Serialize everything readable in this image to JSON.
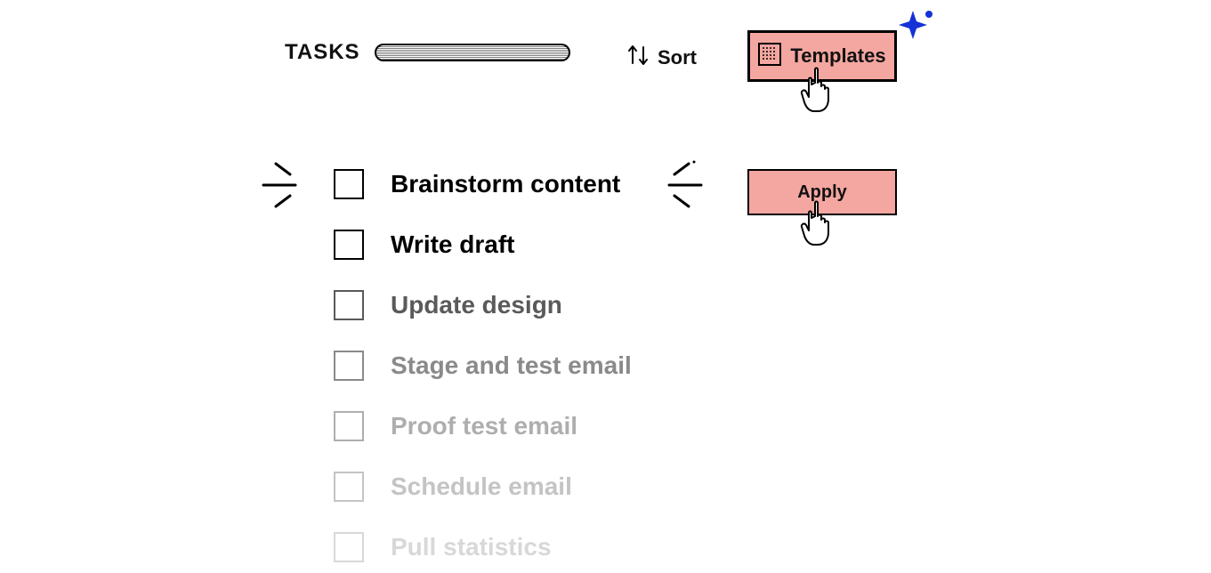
{
  "header": {
    "title": "TASKS",
    "sort_label": "Sort",
    "templates_label": "Templates"
  },
  "buttons": {
    "apply_label": "Apply"
  },
  "tasks": [
    {
      "label": "Brainstorm content",
      "emphasis": "op100",
      "highlighted": true
    },
    {
      "label": "Write draft",
      "emphasis": "op100"
    },
    {
      "label": "Update design",
      "emphasis": "op70"
    },
    {
      "label": "Stage and test email",
      "emphasis": "op55"
    },
    {
      "label": "Proof test email",
      "emphasis": "op40"
    },
    {
      "label": "Schedule email",
      "emphasis": "op30"
    },
    {
      "label": "Pull statistics",
      "emphasis": "op20"
    }
  ],
  "colors": {
    "accent": "#f4a6a0",
    "sparkle": "#1532d6"
  }
}
